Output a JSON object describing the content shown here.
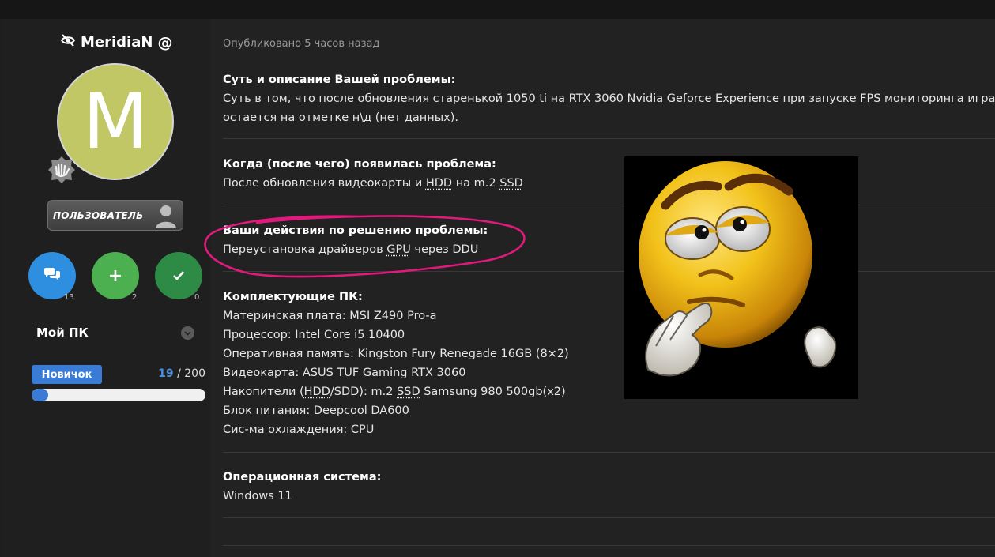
{
  "user": {
    "name": "MeridiaN",
    "avatar_letter": "M",
    "avatar_color": "#c2c766",
    "role": "ПОЛЬЗОВАТЕЛЬ",
    "stats": [
      {
        "icon": "messages-icon",
        "count": "13",
        "color": "#2e8fe0"
      },
      {
        "icon": "plus-icon",
        "count": "2",
        "color": "#4caf50"
      },
      {
        "icon": "check-icon",
        "count": "0",
        "color": "#2e8b45"
      }
    ],
    "my_pc_label": "Мой ПК",
    "level_label": "Новичок",
    "xp_current": "19",
    "xp_sep": " / ",
    "xp_max": "200",
    "xp_fraction": 0.095
  },
  "post": {
    "posted": "Опубликовано 5 часов назад",
    "problem": {
      "heading": "Суть и описание Вашей проблемы:",
      "line1": "Суть в том, что после обновления старенькой 1050 ti на RTX 3060 Nvidia Geforce Experience при запуске FPS мониторинга игра (любая",
      "line2": "остается на отметке н\\д (нет данных)."
    },
    "when": {
      "heading": "Когда (после чего) появилась проблема:",
      "text_a": "После обновления видеокарты и ",
      "abbr1": "HDD",
      "text_b": " на m.2 ",
      "abbr2": "SSD"
    },
    "actions": {
      "heading": "Ваши действия по решению проблемы:",
      "text_a": "Переустановка драйверов ",
      "abbr": "GPU",
      "text_b": " через DDU"
    },
    "components": {
      "heading": "Комплектующие ПК:",
      "motherboard": "Материнская плата: MSI Z490 Pro-a",
      "cpu": "Процессор: Intel Core i5 10400",
      "ram": "Оперативная память: Kingston Fury Renegade 16GB (8×2)",
      "gpu": "Видеокарта: ASUS TUF Gaming RTX 3060",
      "storage_a": "Накопители (",
      "storage_abbr1": "HDD",
      "storage_b": "/SDD): m.2 ",
      "storage_abbr2": "SSD",
      "storage_c": " Samsung 980 500gb(x2)",
      "psu": "Блок питания: Deepcool DA600",
      "cooling": "Сис-ма охлаждения: CPU"
    },
    "os": {
      "heading": "Операционная система:",
      "text": "Windows 11"
    }
  },
  "colors": {
    "highlight": "#e0197d",
    "accent": "#3a7bd5"
  }
}
